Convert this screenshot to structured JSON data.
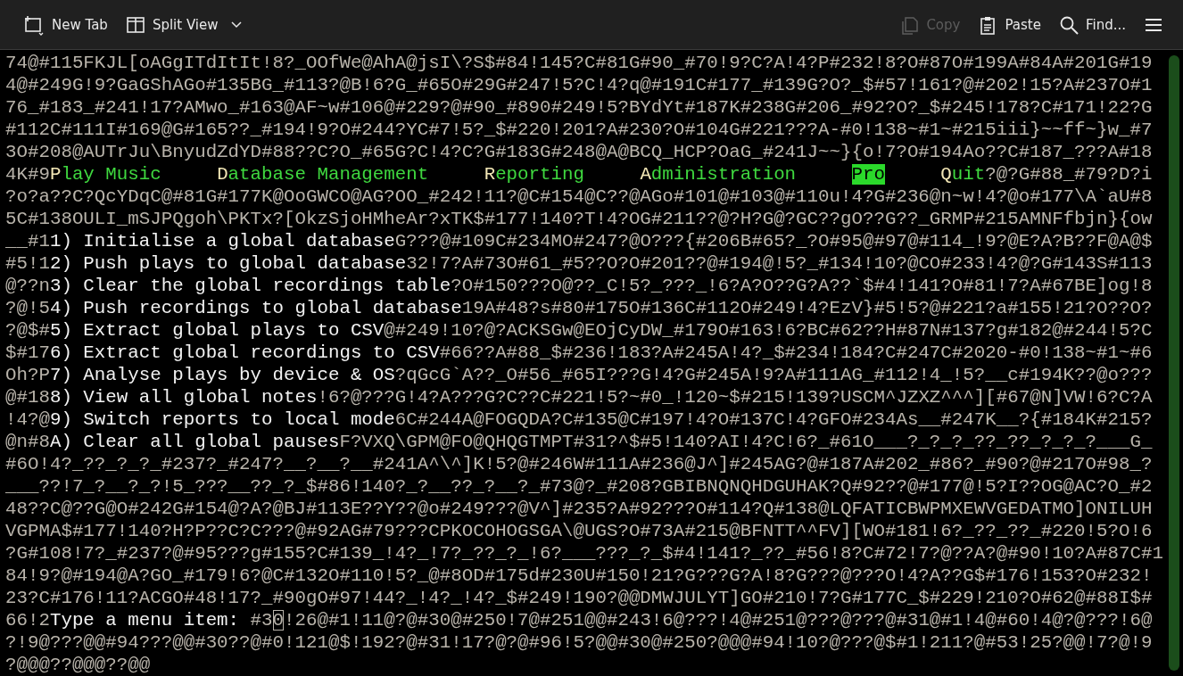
{
  "toolbar": {
    "left": [
      {
        "kind": "new-tab",
        "label": "New Tab",
        "disabled": false
      },
      {
        "kind": "split-view",
        "label": "Split View",
        "disabled": false
      }
    ],
    "right": [
      {
        "kind": "copy",
        "label": "Copy",
        "disabled": true
      },
      {
        "kind": "paste",
        "label": "Paste",
        "disabled": false
      },
      {
        "kind": "find",
        "label": "Find...",
        "disabled": false
      },
      {
        "kind": "menu",
        "disabled": false
      }
    ]
  },
  "terminal": {
    "lines": [
      [
        {
          "kind": "noise",
          "text": "74@#115FKJL[oAGgITdItIt!8?_OOfWe@AhA@jsI\\?S$#84!145?C#81G#90_#70!9?C?A!4?P#232!8?O#87O#199A#84A#201G#19"
        }
      ],
      [
        {
          "kind": "noise",
          "text": "4@#249G!9?GaGShAGo#135BG_#113?@B!6?G_#65O#29G#247!5?C!4?q@#191C#177_#139G?O?_$#57!161?@#202!15?A#237O#1"
        }
      ],
      [
        {
          "kind": "noise",
          "text": "76_#183_#241!17?AMwo_#163@AF~w#106@#229?@#90_#890#249!5?BYdYt#187K#238G#206_#92?O?_$#245!178?C#171!22?G"
        }
      ],
      [
        {
          "kind": "noise",
          "text": "#112C#111I#169@G#165??_#194!9?O#244?YC#7!5?_$#220!201?A#230?O#104G#221???A-#0!138~#1~#215iii}~~ff~}w_#7"
        }
      ],
      [
        {
          "kind": "noise",
          "text": "3O#208@AUTrJu\\BnyudZdYD#88??C?O_#65G?C!4?C?G#183G#248@A@BCQ_HCP?OaG_#241J~~}{o!7?O#194Ao??C#187_???A#18"
        }
      ],
      [
        {
          "kind": "noise",
          "text": "4K#9"
        },
        {
          "kind": "menu",
          "hotkey": "P",
          "text": "lay Music",
          "selected": false
        },
        {
          "kind": "menu",
          "hotkey": "D",
          "text": "atabase Management",
          "selected": false
        },
        {
          "kind": "menu",
          "hotkey": "R",
          "text": "eporting",
          "selected": false
        },
        {
          "kind": "menu",
          "hotkey": "A",
          "text": "dministration",
          "selected": false
        },
        {
          "kind": "menu",
          "text": "Pro",
          "selected": true
        },
        {
          "kind": "menu",
          "hotkey": "Q",
          "text": "uit",
          "selected": false
        },
        {
          "kind": "noise",
          "text": "?@?G#88_#79?D?i"
        }
      ],
      [
        {
          "kind": "noise",
          "text": "?o?a??C?QcYDqC@#81G#177K@OoGWCO@AG?OO_#242!11?@C#154@C??@AGo#101@#103@#110u!4?G#236@n~w!4?@o#177\\A`aU#8"
        }
      ],
      [
        {
          "kind": "noise",
          "text": "5C#138OULI_mSJPQgoh\\PKTx?[OkzSjoHMheAr?xTK$#177!140?T!4?OG#211??@?H?G@?GC??gO??G??_GRMP#215AMNFfbjn}{ow"
        }
      ],
      [
        {
          "kind": "noise",
          "text": "__#1"
        },
        {
          "kind": "option",
          "text": "1) Initialise a global database"
        },
        {
          "kind": "noise",
          "text": "G???@#109C#234MO#247?@O???{#206B#65?_?O#95@#97@#114_!9?@E?A?B??F@A@$"
        }
      ],
      [
        {
          "kind": "noise",
          "text": "#5!1"
        },
        {
          "kind": "option",
          "text": "2) Push plays to global database"
        },
        {
          "kind": "noise",
          "text": "32!7?A#73O#61_#5??O?O#201??@#194@!5?_#134!10?@CO#233!4?@?G#143S#113"
        }
      ],
      [
        {
          "kind": "noise",
          "text": "@??n"
        },
        {
          "kind": "option",
          "text": "3) Clear the global recordings table"
        },
        {
          "kind": "noise",
          "text": "?O#150???O@??_C!5?_???_!6?A?O??G?A??`$#4!141?O#81!7?A#67BE]og!8"
        }
      ],
      [
        {
          "kind": "noise",
          "text": "?@!5"
        },
        {
          "kind": "option",
          "text": "4) Push recordings to global database"
        },
        {
          "kind": "noise",
          "text": "19A#48?s#80#175O#136C#112O#249!4?EzV}#5!5?@#221?a#155!21?O??O?"
        }
      ],
      [
        {
          "kind": "noise",
          "text": "?@$#"
        },
        {
          "kind": "option",
          "text": "5) Extract global plays to CSV"
        },
        {
          "kind": "noise",
          "text": "@#249!10?@?ACKSGw@EOjCyDW_#179O#163!6?BC#62??H#87N#137?g#182@#244!5?C"
        }
      ],
      [
        {
          "kind": "noise",
          "text": "$#17"
        },
        {
          "kind": "option",
          "text": "6) Extract global recordings to CSV"
        },
        {
          "kind": "noise",
          "text": "#66??A#88_$#236!183?A#245A!4?_$#234!184?C#247C#2020-#0!138~#1~#6"
        }
      ],
      [
        {
          "kind": "noise",
          "text": "Oh?P"
        },
        {
          "kind": "option",
          "text": "7) Analyse plays by device & OS"
        },
        {
          "kind": "noise",
          "text": "?qGcG`A??_O#56_#65I???G!4?G#245A!9?A#111AG_#112!4_!5?__c#194K??@o???"
        }
      ],
      [
        {
          "kind": "noise",
          "text": "@#18"
        },
        {
          "kind": "option",
          "text": "8) View all global notes"
        },
        {
          "kind": "noise",
          "text": "!6?@???G!4?A???G?C??C#221!5?~#0_!120~$#215!139?USCM^JZXZ^^^][#67@N]VW!6?C?A"
        }
      ],
      [
        {
          "kind": "noise",
          "text": "!4?@"
        },
        {
          "kind": "option",
          "text": "9) Switch reports to local mode"
        },
        {
          "kind": "noise",
          "text": "6C#244A@FOGQDA?C#135@C#197!4?O#137C!4?GFO#234As__#247K__?{#184K#215?"
        }
      ],
      [
        {
          "kind": "noise",
          "text": "@n#8"
        },
        {
          "kind": "option",
          "text": "A) Clear all global pauses"
        },
        {
          "kind": "noise",
          "text": "F?VXQ\\GPM@FO@QHQGTMPT#31?^$#5!140?AI!4?C!6?_#61O___?_?_?_??_??_?_?_?___G_"
        }
      ],
      [
        {
          "kind": "noise",
          "text": "#6O!4?_??_?_?_#237?_#247?__?__?__#241A^\\^]K!5?@#246W#111A#236@J^]#245AG?@#187A#202_#86?_#90?@#217O#98_?"
        }
      ],
      [
        {
          "kind": "noise",
          "text": "___??!7_?__?_?!5_???__??_?_$#86!140?_?__??_?__?_#73@?_#208?GBIBNQNQHDGUHAK?Q#92??@#177@!5?I??OG@AC?O_#2"
        }
      ],
      [
        {
          "kind": "noise",
          "text": "48??C@??G@O#242G#154@?A?@BJ#113E??Y??@o#249???@V^]#235?A#92???O#114?Q#138@LQFATICBWPMXEWVGEDATMO]ONILUH"
        }
      ],
      [
        {
          "kind": "noise",
          "text": "VGPMA$#177!140?H?P??C?C???@#92AG#79???CPKOCOHOGSGA\\@UGS?O#73A#215@BFNTT^^FV][WO#181!6?_??_??_#220!5?O!6"
        }
      ],
      [
        {
          "kind": "noise",
          "text": "?G#108!7?_#237?@#95???g#155?C#139_!4?_!7?_??_?_!6?___???_?_$#4!141?_??_#56!8?C#72!7?@??A?@#90!10?A#87C#1"
        }
      ],
      [
        {
          "kind": "noise",
          "text": "84!9?@#194@A?GO_#179!6?@C#132O#110!5?_@#8OD#175d#230U#150!21?G???G?A!8?G???@???O!4?A??G$#176!153?O#232!"
        }
      ],
      [
        {
          "kind": "noise",
          "text": "23?C#176!11?ACGO#48!17?_#90gO#97!44?_!4?_!4?_$#249!190?@@DMWJULYT]GO#210!7?G#177C_$#229!210?O#62@#88I$#"
        }
      ],
      [
        {
          "kind": "noise",
          "text": "66!2"
        },
        {
          "kind": "prompt",
          "text": "Type a menu item:"
        },
        {
          "kind": "noise",
          "text": "#3"
        },
        {
          "kind": "cursor",
          "text": "0"
        },
        {
          "kind": "noise",
          "text": "!26@#1!11@?@#30@#250!7@#251@@#243!6@???!4@#251@???@???@#31@#1!4@#60!4@?@???!6@"
        }
      ],
      [
        {
          "kind": "noise",
          "text": "?!9@???@@#94???@@#30??@#0!121@$!192?@#31!17?@?@#96!5?@@#30@#250?@@@#94!10?@???@$#1!211?@#53!25?@@!7?@!9"
        }
      ],
      [
        {
          "kind": "noise",
          "text": "?@@@??@@@??@@"
        }
      ]
    ]
  }
}
